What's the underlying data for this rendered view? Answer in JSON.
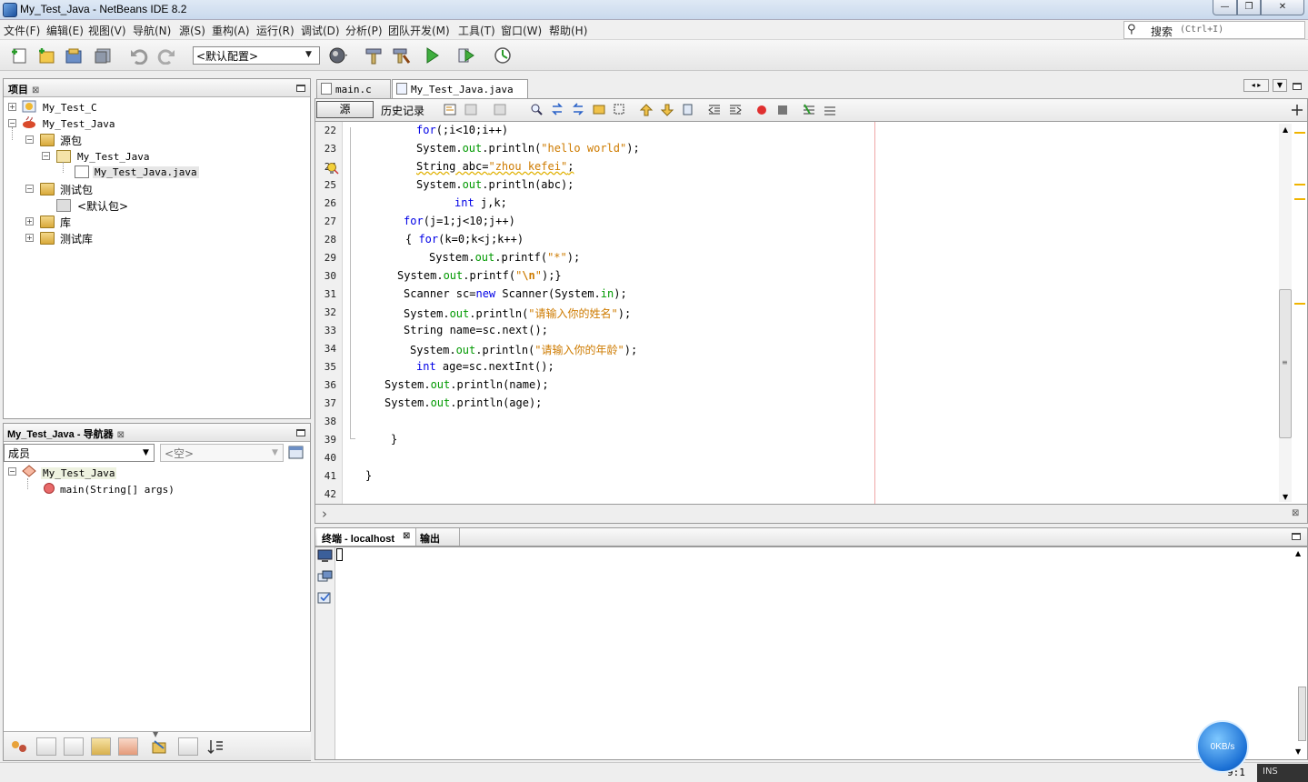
{
  "window": {
    "title": "My_Test_Java - NetBeans IDE 8.2",
    "min": "—",
    "max": "❐",
    "close": "✕"
  },
  "menu": [
    "文件(F)",
    "编辑(E)",
    "视图(V)",
    "导航(N)",
    "源(S)",
    "重构(A)",
    "运行(R)",
    "调试(D)",
    "分析(P)",
    "团队开发(M)",
    "工具(T)",
    "窗口(W)",
    "帮助(H)"
  ],
  "search": {
    "label": "搜索",
    "hint": "(Ctrl+I)"
  },
  "toolbar": {
    "config": "<默认配置>"
  },
  "projects": {
    "title": "项目",
    "close": "⊠",
    "items": [
      {
        "label": "My_Test_C"
      },
      {
        "label": "My_Test_Java"
      },
      {
        "label": "源包"
      },
      {
        "label": "My_Test_Java"
      },
      {
        "label": "My_Test_Java.java"
      },
      {
        "label": "测试包"
      },
      {
        "label": "<默认包>"
      },
      {
        "label": "库"
      },
      {
        "label": "测试库"
      }
    ]
  },
  "navigator": {
    "title": "My_Test_Java - 导航器",
    "close": "⊠",
    "members_combo": "成员",
    "filter_combo": "<空>",
    "class_name": "My_Test_Java",
    "method": "main(String[] args)"
  },
  "editor": {
    "tabs": [
      {
        "label": "main.c"
      },
      {
        "label": "My_Test_Java.java"
      }
    ],
    "tab_close": "⊠",
    "source_btn": "源",
    "history_btn": "历史记录",
    "lines": [
      {
        "n": "22",
        "segs": [
          [
            "kw",
            "for"
          ],
          [
            "",
            "(;i<10;i++)"
          ]
        ]
      },
      {
        "n": "23",
        "segs": [
          [
            "",
            "System."
          ],
          [
            "fld",
            "out"
          ],
          [
            "",
            ".println("
          ],
          [
            "str",
            "\"hello world\""
          ],
          [
            "",
            ");"
          ]
        ]
      },
      {
        "n": "24",
        "segs": [
          [
            "",
            "String abc="
          ],
          [
            "str",
            "\"zhou kefei\""
          ],
          [
            "",
            ";"
          ]
        ]
      },
      {
        "n": "25",
        "segs": [
          [
            "",
            "System."
          ],
          [
            "fld",
            "out"
          ],
          [
            "",
            ".println(abc);"
          ]
        ]
      },
      {
        "n": "26",
        "segs": [
          [
            "kw",
            "int"
          ],
          [
            "",
            " j,k;"
          ]
        ]
      },
      {
        "n": "27",
        "segs": [
          [
            "kw",
            "for"
          ],
          [
            "",
            "(j=1;j<10;j++)"
          ]
        ]
      },
      {
        "n": "28",
        "segs": [
          [
            "",
            "{ "
          ],
          [
            "kw",
            "for"
          ],
          [
            "",
            "(k=0;k<j;k++)"
          ]
        ]
      },
      {
        "n": "29",
        "segs": [
          [
            "",
            "System."
          ],
          [
            "fld",
            "out"
          ],
          [
            "",
            ".printf("
          ],
          [
            "str",
            "\"*\""
          ],
          [
            "",
            ");"
          ]
        ]
      },
      {
        "n": "30",
        "segs": [
          [
            "",
            "System."
          ],
          [
            "fld",
            "out"
          ],
          [
            "",
            ".printf("
          ],
          [
            "str",
            "\""
          ],
          [
            "strb",
            "\\n"
          ],
          [
            "str",
            "\""
          ],
          [
            "",
            ");}"
          ]
        ]
      },
      {
        "n": "31",
        "segs": [
          [
            "",
            "Scanner sc="
          ],
          [
            "kw",
            "new"
          ],
          [
            "",
            " Scanner(System."
          ],
          [
            "fld",
            "in"
          ],
          [
            "",
            ");"
          ]
        ]
      },
      {
        "n": "32",
        "segs": [
          [
            "",
            "System."
          ],
          [
            "fld",
            "out"
          ],
          [
            "",
            ".println("
          ],
          [
            "str",
            "\"请输入你的姓名\""
          ],
          [
            "",
            ");"
          ]
        ]
      },
      {
        "n": "33",
        "segs": [
          [
            "",
            "String name=sc.next();"
          ]
        ]
      },
      {
        "n": "34",
        "segs": [
          [
            "",
            "System."
          ],
          [
            "fld",
            "out"
          ],
          [
            "",
            ".println("
          ],
          [
            "str",
            "\"请输入你的年龄\""
          ],
          [
            "",
            ");"
          ]
        ]
      },
      {
        "n": "35",
        "segs": [
          [
            "kw",
            "int"
          ],
          [
            "",
            " age=sc.nextInt();"
          ]
        ]
      },
      {
        "n": "36",
        "segs": [
          [
            "",
            "System."
          ],
          [
            "fld",
            "out"
          ],
          [
            "",
            ".println(name);"
          ]
        ]
      },
      {
        "n": "37",
        "segs": [
          [
            "",
            "System."
          ],
          [
            "fld",
            "out"
          ],
          [
            "",
            ".println(age);"
          ]
        ]
      },
      {
        "n": "38",
        "segs": []
      },
      {
        "n": "39",
        "segs": [
          [
            "",
            "}"
          ]
        ]
      },
      {
        "n": "40",
        "segs": []
      },
      {
        "n": "41",
        "segs": [
          [
            "",
            "}"
          ]
        ]
      },
      {
        "n": "42",
        "segs": []
      }
    ]
  },
  "output": {
    "tabs": [
      {
        "label": "终端 - localhost"
      },
      {
        "label": "输出"
      }
    ],
    "tab_close": "⊠"
  },
  "status": {
    "cursor": "9:1",
    "mode": "INS",
    "net_speed": "0KB/s"
  }
}
